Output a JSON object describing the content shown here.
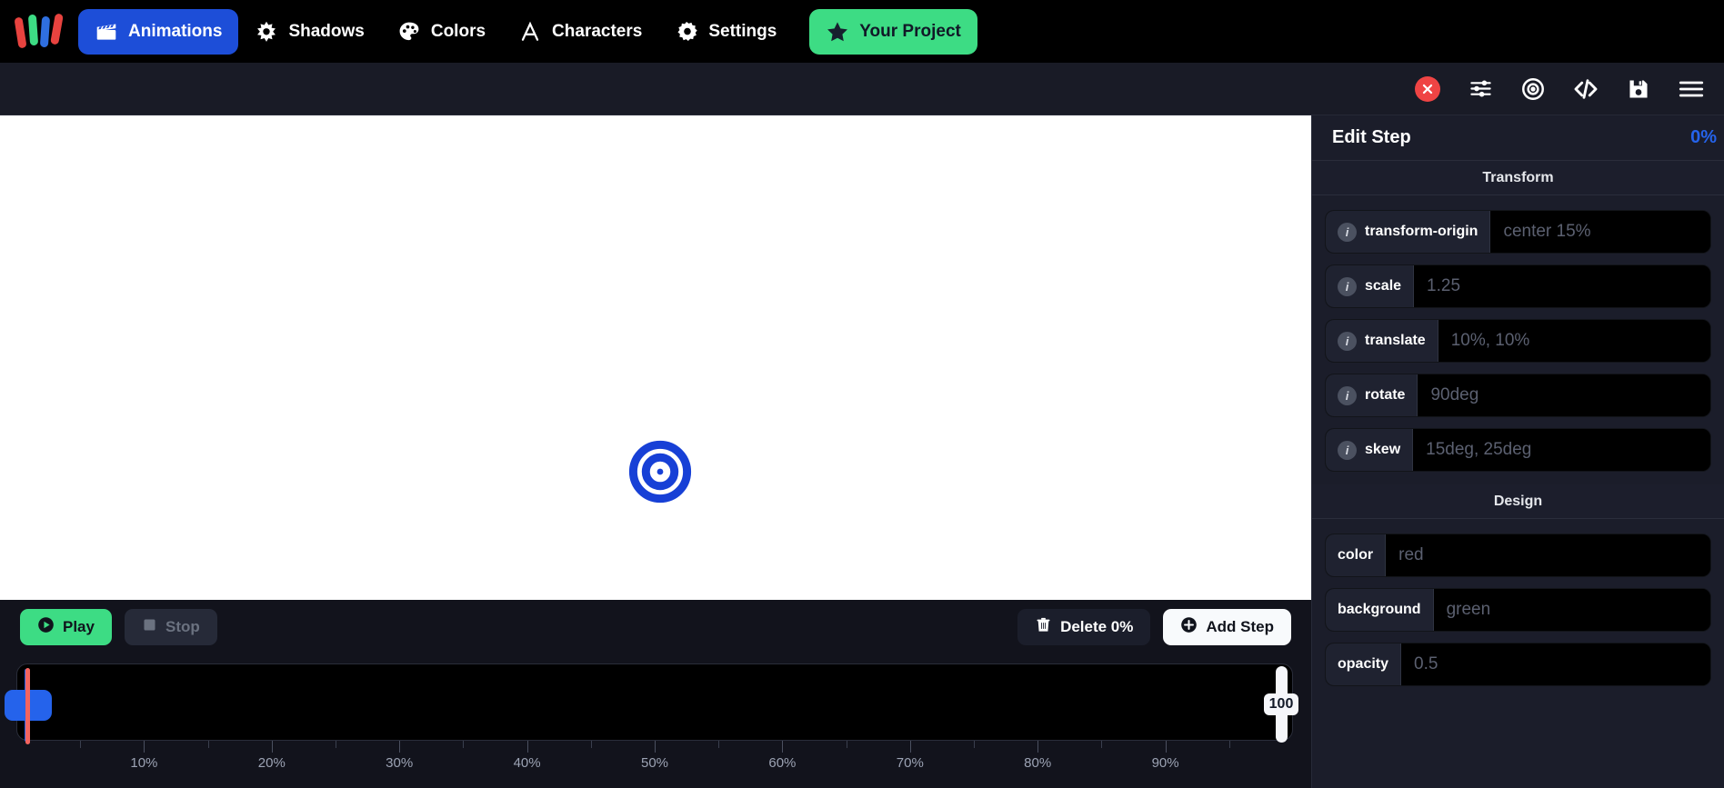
{
  "nav": {
    "logo_name": "app-logo",
    "logo_bars": [
      {
        "color": "#e8433f",
        "rotate": -9,
        "x": 3,
        "y": 7
      },
      {
        "color": "#3ddc84",
        "rotate": -4,
        "x": 17,
        "y": 4
      },
      {
        "color": "#2f6fe0",
        "rotate": 3,
        "x": 31,
        "y": 6
      },
      {
        "color": "#e8433f",
        "rotate": 9,
        "x": 44,
        "y": 3
      }
    ],
    "items": [
      {
        "label": "Animations",
        "icon": "clapperboard-icon",
        "active": true
      },
      {
        "label": "Shadows",
        "icon": "sun-icon",
        "active": false
      },
      {
        "label": "Colors",
        "icon": "palette-icon",
        "active": false
      },
      {
        "label": "Characters",
        "icon": "letter-a-icon",
        "active": false
      },
      {
        "label": "Settings",
        "icon": "gear-icon",
        "active": false
      }
    ],
    "project_button": {
      "label": "Your Project",
      "icon": "star-icon"
    }
  },
  "toolbar": {
    "buttons": [
      {
        "name": "close-button",
        "icon": "close-x-icon"
      },
      {
        "name": "sliders-button",
        "icon": "sliders-icon"
      },
      {
        "name": "target-button",
        "icon": "target-icon"
      },
      {
        "name": "code-button",
        "icon": "code-brackets-icon"
      },
      {
        "name": "save-button",
        "icon": "floppy-save-icon"
      },
      {
        "name": "menu-button",
        "icon": "hamburger-menu-icon"
      }
    ],
    "accent_close": "#ef4444"
  },
  "canvas": {
    "background": "#ffffff",
    "element": {
      "name": "target-shape",
      "color": "#1740d6",
      "shape": "bullseye"
    }
  },
  "playback": {
    "play_label": "Play",
    "stop_label": "Stop",
    "delete_label": "Delete 0%",
    "add_step_label": "Add Step",
    "play_color": "#3ddc84"
  },
  "timeline": {
    "current_step_percent": 0,
    "playhead_percent": 0,
    "end_marker_label": "100",
    "major_ticks": [
      "10%",
      "20%",
      "30%",
      "40%",
      "50%",
      "60%",
      "70%",
      "80%",
      "90%"
    ],
    "major_tick_values": [
      10,
      20,
      30,
      40,
      50,
      60,
      70,
      80,
      90
    ],
    "minor_tick_values": [
      5,
      15,
      25,
      35,
      45,
      55,
      65,
      75,
      85,
      95
    ],
    "step_color": "#2563eb",
    "playhead_color": "#f4645f"
  },
  "panel": {
    "title": "Edit Step",
    "percent": "0%",
    "percent_color": "#2563eb",
    "sections": [
      {
        "name": "Transform",
        "fields": [
          {
            "label": "transform-origin",
            "value": "center 15%",
            "info": true
          },
          {
            "label": "scale",
            "value": "1.25",
            "info": true
          },
          {
            "label": "translate",
            "value": "10%, 10%",
            "info": true
          },
          {
            "label": "rotate",
            "value": "90deg",
            "info": true
          },
          {
            "label": "skew",
            "value": "15deg, 25deg",
            "info": true
          }
        ]
      },
      {
        "name": "Design",
        "fields": [
          {
            "label": "color",
            "value": "red",
            "info": false
          },
          {
            "label": "background",
            "value": "green",
            "info": false
          },
          {
            "label": "opacity",
            "value": "0.5",
            "info": false
          }
        ]
      }
    ]
  }
}
